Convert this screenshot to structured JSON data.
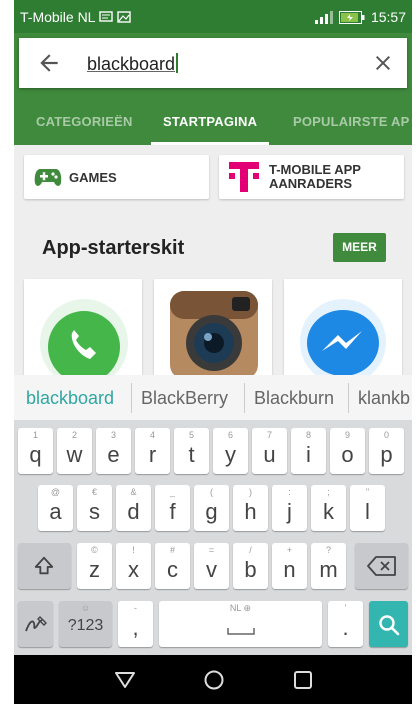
{
  "status_bar": {
    "carrier": "T-Mobile NL",
    "time": "15:57"
  },
  "search": {
    "query": "blackboard"
  },
  "tabs": [
    {
      "label": "CATEGORIEËN"
    },
    {
      "label": "STARTPAGINA"
    },
    {
      "label": "POPULAIRSTE AP"
    }
  ],
  "chips": {
    "games": "GAMES",
    "tmobile_line1": "T-MOBILE APP",
    "tmobile_line2": "AANRADERS"
  },
  "section": {
    "title": "App-starterskit",
    "more": "MEER"
  },
  "suggestions": [
    "blackboard",
    "BlackBerry",
    "Blackburn",
    "klankb"
  ],
  "keyboard": {
    "row1": [
      {
        "k": "q",
        "h": "1"
      },
      {
        "k": "w",
        "h": "2"
      },
      {
        "k": "e",
        "h": "3"
      },
      {
        "k": "r",
        "h": "4"
      },
      {
        "k": "t",
        "h": "5"
      },
      {
        "k": "y",
        "h": "6"
      },
      {
        "k": "u",
        "h": "7"
      },
      {
        "k": "i",
        "h": "8"
      },
      {
        "k": "o",
        "h": "9"
      },
      {
        "k": "p",
        "h": "0"
      }
    ],
    "row2": [
      {
        "k": "a",
        "h": "@"
      },
      {
        "k": "s",
        "h": "€"
      },
      {
        "k": "d",
        "h": "&"
      },
      {
        "k": "f",
        "h": "_"
      },
      {
        "k": "g",
        "h": "("
      },
      {
        "k": "h",
        "h": ")"
      },
      {
        "k": "j",
        "h": ":"
      },
      {
        "k": "k",
        "h": ";"
      },
      {
        "k": "l",
        "h": "\""
      }
    ],
    "row3": [
      {
        "k": "z",
        "h": "©"
      },
      {
        "k": "x",
        "h": "!"
      },
      {
        "k": "c",
        "h": "#"
      },
      {
        "k": "v",
        "h": "="
      },
      {
        "k": "b",
        "h": "/"
      },
      {
        "k": "n",
        "h": "+"
      },
      {
        "k": "m",
        "h": "?"
      }
    ],
    "sym_label": "?123",
    "sym_hint": "☺",
    "comma": ",",
    "comma_hint": "-",
    "space_hint": "NL ⊕",
    "period": ".",
    "period_hint": "'"
  },
  "colors": {
    "status_bar": "#2e7d32",
    "header": "#3f8a3c",
    "accent_teal": "#33b5b0",
    "suggestion_active": "#2fa7a3"
  },
  "icons": {
    "back": "arrow-left-icon",
    "clear": "close-icon",
    "games": "gamepad-icon",
    "tmobile": "t-mobile-logo-icon",
    "search_key": "search-icon",
    "backspace": "backspace-icon",
    "shift": "shift-icon",
    "handwriting": "handwriting-icon"
  }
}
